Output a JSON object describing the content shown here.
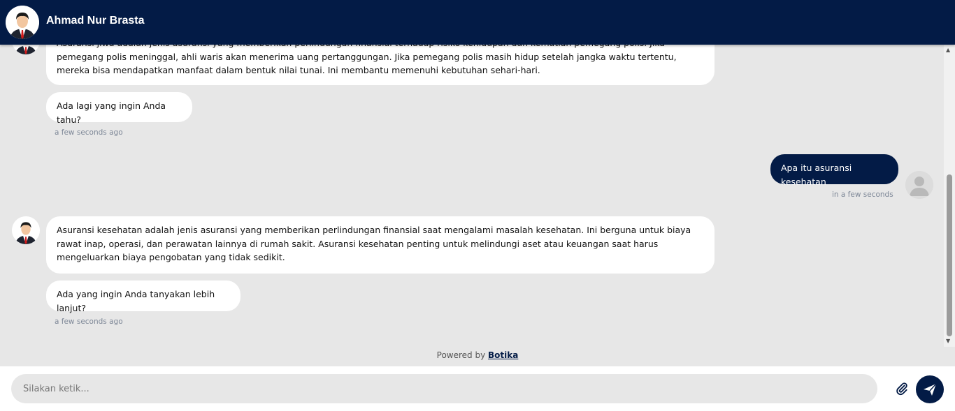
{
  "header": {
    "title": "Ahmad Nur Brasta"
  },
  "messages": {
    "bot1_text": "Asuransi jiwa adalah jenis asuransi yang memberikan perlindungan finansial terhadap risiko kehidupan dan kematian pemegang polis. Jika pemegang polis meninggal, ahli waris akan menerima uang pertanggungan. Jika pemegang polis masih hidup setelah jangka waktu tertentu, mereka bisa mendapatkan manfaat dalam bentuk nilai tunai. Ini membantu memenuhi kebutuhan sehari-hari.",
    "bot2_text": "Ada lagi yang ingin Anda tahu?",
    "bot_ts_1": "a few seconds ago",
    "user_text": "Apa itu asuransi kesehatan",
    "user_ts": "in a few seconds",
    "bot3_text": "Asuransi kesehatan adalah jenis asuransi yang memberikan perlindungan finansial saat mengalami masalah kesehatan. Ini berguna untuk biaya rawat inap, operasi, dan perawatan lainnya di rumah sakit. Asuransi kesehatan penting untuk melindungi aset atau keuangan saat harus mengeluarkan biaya pengobatan yang tidak sedikit.",
    "bot4_text": "Ada yang ingin Anda tanyakan lebih lanjut?",
    "bot_ts_2": "a few seconds ago"
  },
  "footer": {
    "powered_prefix": "Powered by",
    "powered_brand": "Botika",
    "input_placeholder": "Silakan ketik..."
  },
  "icons": {
    "attach": "paperclip-icon",
    "send": "send-icon",
    "user_avatar": "user-avatar-icon"
  },
  "colors": {
    "brand": "#031b46",
    "background": "#e7e7e7"
  }
}
